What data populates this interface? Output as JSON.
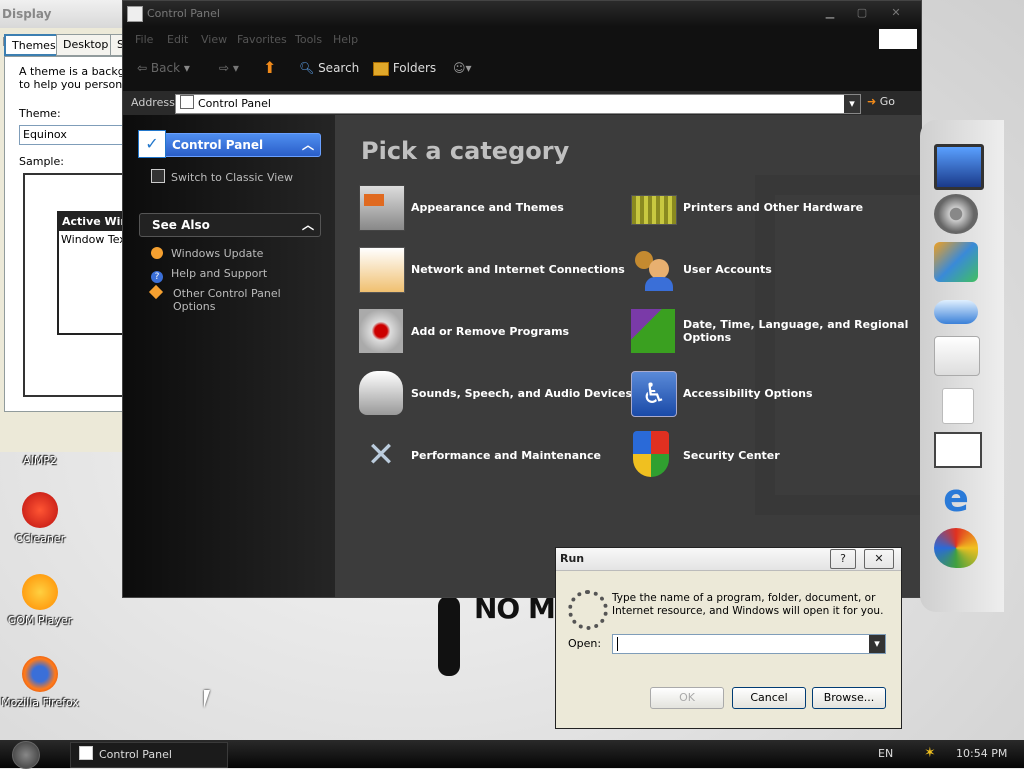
{
  "desktop": {
    "icons": [
      {
        "label": "AIMP2"
      },
      {
        "label": "CCleaner"
      },
      {
        "label": "GOM Player"
      },
      {
        "label": "Mozilla Firefox"
      }
    ],
    "wallpaper_text": "NO MU"
  },
  "display_properties": {
    "title": "Display Properties",
    "tabs": [
      "Themes",
      "Desktop",
      "S"
    ],
    "description": "A theme is a backgro... to help you personaliz...",
    "desc_line1": "A theme is a backgro",
    "desc_line2": "to help you personaliz",
    "theme_label": "Theme:",
    "theme_value": "Equinox",
    "sample_label": "Sample:",
    "active_window": "Active Wind",
    "window_text": "Window Text"
  },
  "control_panel": {
    "title": "Control Panel",
    "menu": [
      "File",
      "Edit",
      "View",
      "Favorites",
      "Tools",
      "Help"
    ],
    "toolbar": {
      "back": "Back",
      "search": "Search",
      "folders": "Folders"
    },
    "address_label": "Address",
    "address_value": "Control Panel",
    "go_label": "Go",
    "left": {
      "panel_title": "Control Panel",
      "switch_view": "Switch to Classic View",
      "see_also_title": "See Also",
      "see_also": [
        "Windows Update",
        "Help and Support",
        "Other Control Panel Options"
      ],
      "see_also_3_line1": "Other Control Panel",
      "see_also_3_line2": "Options"
    },
    "heading": "Pick a category",
    "categories": [
      {
        "label": "Appearance and Themes"
      },
      {
        "label": "Printers and Other Hardware"
      },
      {
        "label": "Network and Internet Connections"
      },
      {
        "label": "User Accounts"
      },
      {
        "label": "Add or Remove Programs"
      },
      {
        "label": "Date, Time, Language, and Regional Options",
        "line1": "Date, Time, Language, and Regional",
        "line2": "Options"
      },
      {
        "label": "Sounds, Speech, and Audio Devices"
      },
      {
        "label": "Accessibility Options"
      },
      {
        "label": "Performance and Maintenance"
      },
      {
        "label": "Security Center"
      }
    ]
  },
  "run_dialog": {
    "title": "Run",
    "help_glyph": "?",
    "close_glyph": "✕",
    "description_line1": "Type the name of a program, folder, document, or",
    "description_line2": "Internet resource, and Windows will open it for you.",
    "open_label": "Open:",
    "open_value": "",
    "ok": "OK",
    "cancel": "Cancel",
    "browse": "Browse..."
  },
  "taskbar": {
    "task": "Control Panel",
    "language": "EN",
    "clock": "10:54 PM"
  },
  "icons": {
    "back": "back-arrow-icon",
    "forward": "forward-arrow-icon",
    "up": "up-arrow-icon",
    "search": "magnifier-icon",
    "folders": "folders-icon",
    "views": "views-icon",
    "go": "go-arrow-icon"
  },
  "colors": {
    "accent": "#3a78d8",
    "pane_dark": "#3c3c3c"
  }
}
